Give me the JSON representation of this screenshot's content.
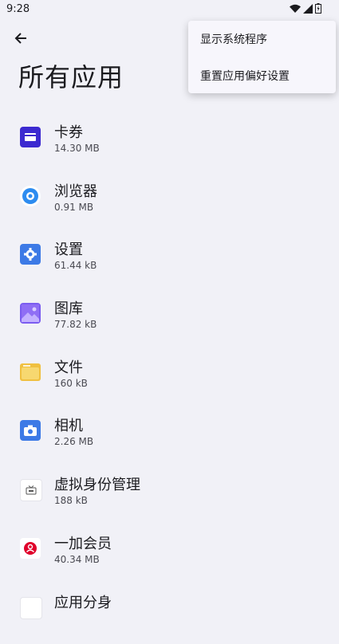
{
  "status_bar": {
    "time": "9:28",
    "icons": [
      "wifi-icon",
      "cellular-signal-icon",
      "battery-charging-icon"
    ]
  },
  "header": {
    "back_icon": "arrow-left-icon",
    "title": "所有应用"
  },
  "apps": [
    {
      "name": "卡券",
      "size": "14.30 MB",
      "icon": "wallet-icon",
      "color": "#3c2ad0"
    },
    {
      "name": "浏览器",
      "size": "0.91 MB",
      "icon": "browser-icon",
      "color": "#2d8cf0"
    },
    {
      "name": "设置",
      "size": "61.44 kB",
      "icon": "settings-gear-icon",
      "color": "#3d7ae6"
    },
    {
      "name": "图库",
      "size": "77.82 kB",
      "icon": "gallery-icon",
      "color": "#7b5cf0"
    },
    {
      "name": "文件",
      "size": "160 kB",
      "icon": "folder-icon",
      "color": "#f0c040"
    },
    {
      "name": "相机",
      "size": "2.26 MB",
      "icon": "camera-icon",
      "color": "#3d7ae6"
    },
    {
      "name": "虚拟身份管理",
      "size": "188 kB",
      "icon": "virtual-identity-icon",
      "color": "#ffffff"
    },
    {
      "name": "一加会员",
      "size": "40.34 MB",
      "icon": "oneplus-member-icon",
      "color": "#e0002a"
    },
    {
      "name": "应用分身",
      "size": "",
      "icon": "app-clone-icon",
      "color": "#ffffff"
    }
  ],
  "overflow_menu": {
    "items": [
      {
        "label": "显示系统程序"
      },
      {
        "label": "重置应用偏好设置"
      }
    ]
  }
}
